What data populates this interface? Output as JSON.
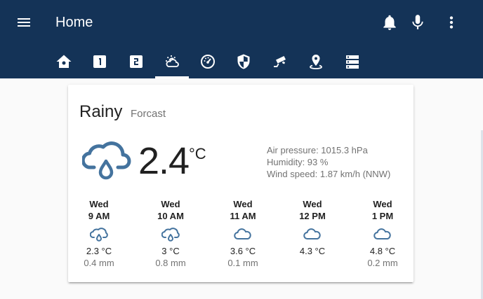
{
  "header": {
    "title": "Home",
    "menu_icon": "menu-icon",
    "actions": [
      "bell-icon",
      "microphone-icon",
      "more-vert-icon"
    ],
    "tabs": [
      {
        "icon": "home-icon"
      },
      {
        "icon": "numeric-1-box-icon"
      },
      {
        "icon": "numeric-2-box-icon"
      },
      {
        "icon": "weather-partly-cloudy-icon",
        "active": true
      },
      {
        "icon": "gauge-icon"
      },
      {
        "icon": "security-shield-icon"
      },
      {
        "icon": "cctv-camera-icon"
      },
      {
        "icon": "map-marker-radius-icon"
      },
      {
        "icon": "server-icon"
      }
    ],
    "bg_color": "#143357"
  },
  "weather": {
    "condition": "Rainy",
    "forecast_label": "Forcast",
    "icon": "cloud-rain-icon",
    "temperature": "2.4",
    "unit": "°C",
    "attributes": {
      "pressure": "Air pressure: 1015.3 hPa",
      "humidity": "Humidity: 93 %",
      "wind": "Wind speed: 1.87 km/h (NNW)"
    },
    "icon_color": "#44739e",
    "forecast": [
      {
        "day": "Wed",
        "time": "9 AM",
        "icon": "cloud-rain-icon",
        "temp": "2.3 °C",
        "precip": "0.4 mm"
      },
      {
        "day": "Wed",
        "time": "10 AM",
        "icon": "cloud-rain-icon",
        "temp": "3 °C",
        "precip": "0.8 mm"
      },
      {
        "day": "Wed",
        "time": "11 AM",
        "icon": "cloud-icon",
        "temp": "3.6 °C",
        "precip": "0.1 mm"
      },
      {
        "day": "Wed",
        "time": "12 PM",
        "icon": "cloud-icon",
        "temp": "4.3 °C",
        "precip": ""
      },
      {
        "day": "Wed",
        "time": "1 PM",
        "icon": "cloud-icon",
        "temp": "4.8 °C",
        "precip": "0.2 mm"
      }
    ]
  }
}
